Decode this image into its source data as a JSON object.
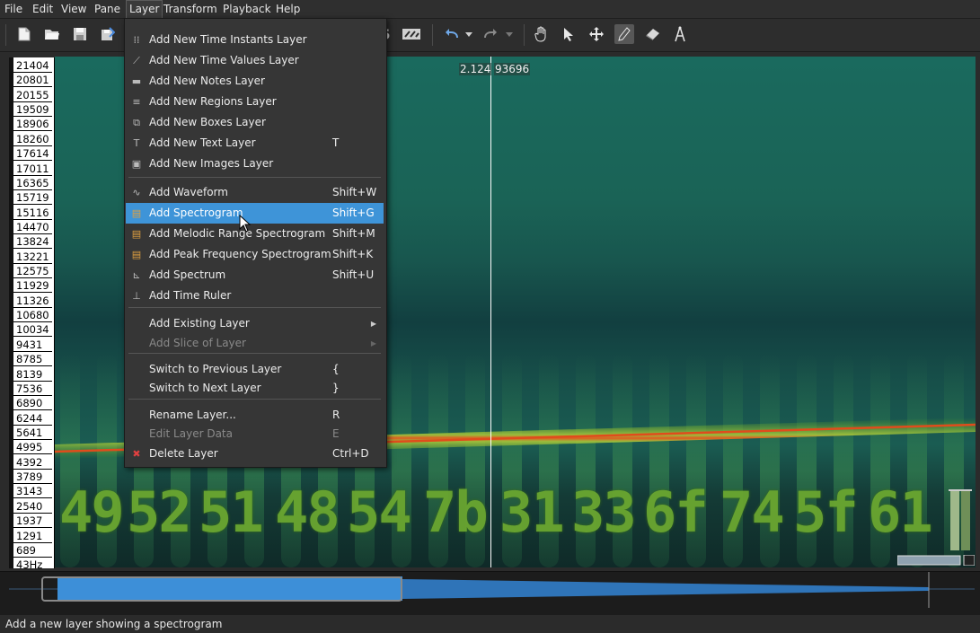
{
  "menubar": {
    "items": [
      "File",
      "Edit",
      "View",
      "Pane",
      "Layer",
      "Transform",
      "Playback",
      "Help"
    ]
  },
  "ruler": {
    "ticks": [
      "21404",
      "20801",
      "20155",
      "19509",
      "18906",
      "18260",
      "17614",
      "17011",
      "16365",
      "15719",
      "15116",
      "14470",
      "13824",
      "13221",
      "12575",
      "11929",
      "11326",
      "10680",
      "10034",
      "9431",
      "8785",
      "8139",
      "7536",
      "6890",
      "6244",
      "5641",
      "4995",
      "4392",
      "3789",
      "3143",
      "2540",
      "1937",
      "1291",
      "689",
      "43Hz"
    ]
  },
  "cursor": {
    "time": "2.124",
    "freq": "93696"
  },
  "hex_glyphs": [
    "49",
    "52",
    "51",
    "48",
    "54",
    "7b",
    "31",
    "33",
    "6f",
    "74",
    "5f",
    "61"
  ],
  "layer_menu": {
    "items": [
      {
        "icon": "time-instants-icon",
        "label": "Add New Time Instants Layer",
        "shortcut": ""
      },
      {
        "icon": "time-values-icon",
        "label": "Add New Time Values Layer",
        "shortcut": ""
      },
      {
        "icon": "notes-icon",
        "label": "Add New Notes Layer",
        "shortcut": ""
      },
      {
        "icon": "regions-icon",
        "label": "Add New Regions Layer",
        "shortcut": ""
      },
      {
        "icon": "boxes-icon",
        "label": "Add New Boxes Layer",
        "shortcut": ""
      },
      {
        "icon": "text-icon",
        "label": "Add New Text Layer",
        "shortcut": "T"
      },
      {
        "icon": "images-icon",
        "label": "Add New Images Layer",
        "shortcut": ""
      },
      {
        "icon": "waveform-icon",
        "label": "Add Waveform",
        "shortcut": "Shift+W"
      },
      {
        "icon": "spectrogram-icon",
        "label": "Add Spectrogram",
        "shortcut": "Shift+G"
      },
      {
        "icon": "melodic-spectrogram-icon",
        "label": "Add Melodic Range Spectrogram",
        "shortcut": "Shift+M"
      },
      {
        "icon": "peak-spectrogram-icon",
        "label": "Add Peak Frequency Spectrogram",
        "shortcut": "Shift+K"
      },
      {
        "icon": "spectrum-icon",
        "label": "Add Spectrum",
        "shortcut": "Shift+U"
      },
      {
        "icon": "time-ruler-icon",
        "label": "Add Time Ruler",
        "shortcut": ""
      },
      {
        "icon": "",
        "label": "Add Existing Layer",
        "shortcut": ""
      },
      {
        "icon": "",
        "label": "Add Slice of Layer",
        "shortcut": ""
      },
      {
        "icon": "",
        "label": "Switch to Previous Layer",
        "shortcut": "{"
      },
      {
        "icon": "",
        "label": "Switch to Next Layer",
        "shortcut": "}"
      },
      {
        "icon": "",
        "label": "Rename Layer...",
        "shortcut": "R"
      },
      {
        "icon": "",
        "label": "Edit Layer Data",
        "shortcut": "E"
      },
      {
        "icon": "delete-icon",
        "label": "Delete Layer",
        "shortcut": "Ctrl+D"
      }
    ],
    "highlighted": "Add Spectrogram",
    "disabled": [
      "Add Slice of Layer",
      "Edit Layer Data"
    ]
  },
  "status": {
    "text": "Add a new layer showing a spectrogram"
  },
  "colors": {
    "highlight": "#3e94d8",
    "menu_bg": "#363636",
    "spectral_line": "#e0a020"
  }
}
